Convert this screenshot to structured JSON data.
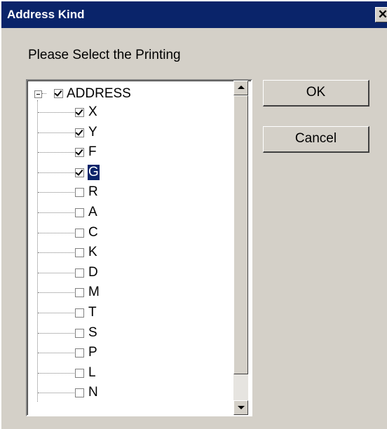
{
  "window": {
    "title": "Address Kind",
    "close_glyph": "✕"
  },
  "prompt": "Please Select the Printing",
  "tree": {
    "root": {
      "label": "ADDRESS",
      "checked": true,
      "expanded": true
    },
    "items": [
      {
        "label": "X",
        "checked": true
      },
      {
        "label": "Y",
        "checked": true
      },
      {
        "label": "F",
        "checked": true
      },
      {
        "label": "G",
        "checked": true,
        "selected": true
      },
      {
        "label": "R",
        "checked": false
      },
      {
        "label": "A",
        "checked": false
      },
      {
        "label": "C",
        "checked": false
      },
      {
        "label": "K",
        "checked": false
      },
      {
        "label": "D",
        "checked": false
      },
      {
        "label": "M",
        "checked": false
      },
      {
        "label": "T",
        "checked": false
      },
      {
        "label": "S",
        "checked": false
      },
      {
        "label": "P",
        "checked": false
      },
      {
        "label": "L",
        "checked": false
      },
      {
        "label": "N",
        "checked": false
      }
    ]
  },
  "buttons": {
    "ok": "OK",
    "cancel": "Cancel"
  },
  "colors": {
    "titlebar": "#0a246a",
    "face": "#d4d0c8",
    "selection": "#0a246a"
  }
}
